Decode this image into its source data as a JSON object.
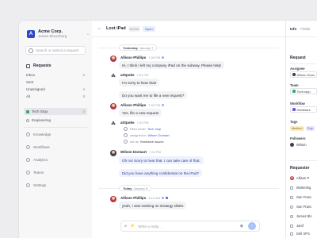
{
  "sidebar": {
    "org_name": "Acme Corp.",
    "org_user": "James Bloomberg",
    "search_placeholder": "Search or submit a request",
    "requests_label": "Requests",
    "subitems": [
      {
        "label": "Inbox",
        "count": "2"
      },
      {
        "label": "Sent",
        "count": ""
      },
      {
        "label": "Unassigned",
        "count": "4"
      },
      {
        "label": "All",
        "count": "8"
      }
    ],
    "teams": [
      {
        "label": "Tech Stop",
        "count": "2"
      },
      {
        "label": "Engineering",
        "count": ""
      }
    ],
    "nav": [
      "Knowledge",
      "Workflows",
      "Analytics",
      "Teams",
      "Settings"
    ]
  },
  "topbar": {
    "back": "←",
    "title": "Lost iPad",
    "id": "#1234",
    "status": "Open"
  },
  "thread": {
    "day1": {
      "label": "Yesterday",
      "date": "January 7"
    },
    "day2": {
      "label": "Today",
      "date": "January 8"
    },
    "messages": [
      {
        "name": "Allison Phillips",
        "time": "7:00 PM",
        "text": "Hi, I think I left my company iPad on the subway. Please help!"
      },
      {
        "name": "atSpoke",
        "time": "7:01 PM",
        "text": "I'm sorry to hear that!"
      },
      {
        "name": "",
        "time": "",
        "text": "Do you want me to file a new request?"
      },
      {
        "name": "Allison Phillips",
        "time": "7:02 PM",
        "text": "Yes, file a new request"
      },
      {
        "name": "atSpoke",
        "time": "7:02 PM",
        "text": ""
      },
      {
        "name": "Wilson Dorwart",
        "time": "7:24 PM",
        "text": "Oh no! Sorry to hear that. I can take care of that."
      },
      {
        "name": "",
        "time": "",
        "text": "Did you have anything confidential on the iPad?"
      },
      {
        "name": "Allison Phillips",
        "time": "9:10 AM",
        "text": "yeah, I was working on strategy slides"
      }
    ],
    "events": [
      {
        "text": "Filed under",
        "value": "Tech stop"
      },
      {
        "text": "assigned to",
        "value": "Wilson Dorwart"
      },
      {
        "text": "set as",
        "value": "Hardware issues"
      }
    ],
    "composer_placeholder": "Write a reply...",
    "send_icon": "↑"
  },
  "rpanel": {
    "tabs": [
      "Info",
      "Fields"
    ],
    "request_title": "Request",
    "assignee_label": "Assignee",
    "assignee_value": "Wilson Dorw",
    "team_label": "Team",
    "team_value": "Tech stop",
    "workflow_label": "Workflow",
    "workflow_value": "Hardware",
    "tags_label": "Tags",
    "tags": [
      "Medium",
      "Pop"
    ],
    "followers_label": "Followers",
    "follower_value": "Wilson",
    "requester_title": "Requester",
    "requester_rows": [
      "Allison P",
      "Marketing",
      "San Franc",
      "San Franc",
      "James Blo",
      "Jamf",
      "Dell XPS"
    ]
  },
  "colors": {
    "accent": "#3a63d8",
    "brand": "#2b49c9"
  }
}
